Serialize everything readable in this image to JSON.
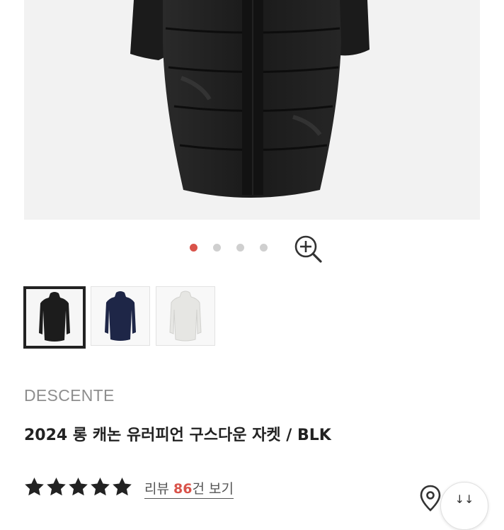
{
  "product": {
    "brand": "DESCENTE",
    "title": "2024 롱 캐논 유러피언 구스다운 자켓 / BLK",
    "rating_stars": 5,
    "review": {
      "prefix": "리뷰 ",
      "count": "86",
      "suffix": "건 보기"
    }
  },
  "gallery": {
    "total_slides": 4,
    "active_slide": 1,
    "thumbnails": [
      {
        "color_name": "black",
        "color": "#1c1c1c",
        "selected": true
      },
      {
        "color_name": "navy",
        "color": "#1e2647",
        "selected": false
      },
      {
        "color_name": "white",
        "color": "#ececea",
        "selected": false
      }
    ]
  },
  "colors": {
    "accent": "#d9534a",
    "star": "#222222",
    "hero_bg": "#f2f2f2"
  },
  "icons": {
    "zoom": "zoom-in-icon",
    "star": "star-icon",
    "location": "location-pin-icon"
  },
  "float_button": {
    "label": "↓↓"
  }
}
